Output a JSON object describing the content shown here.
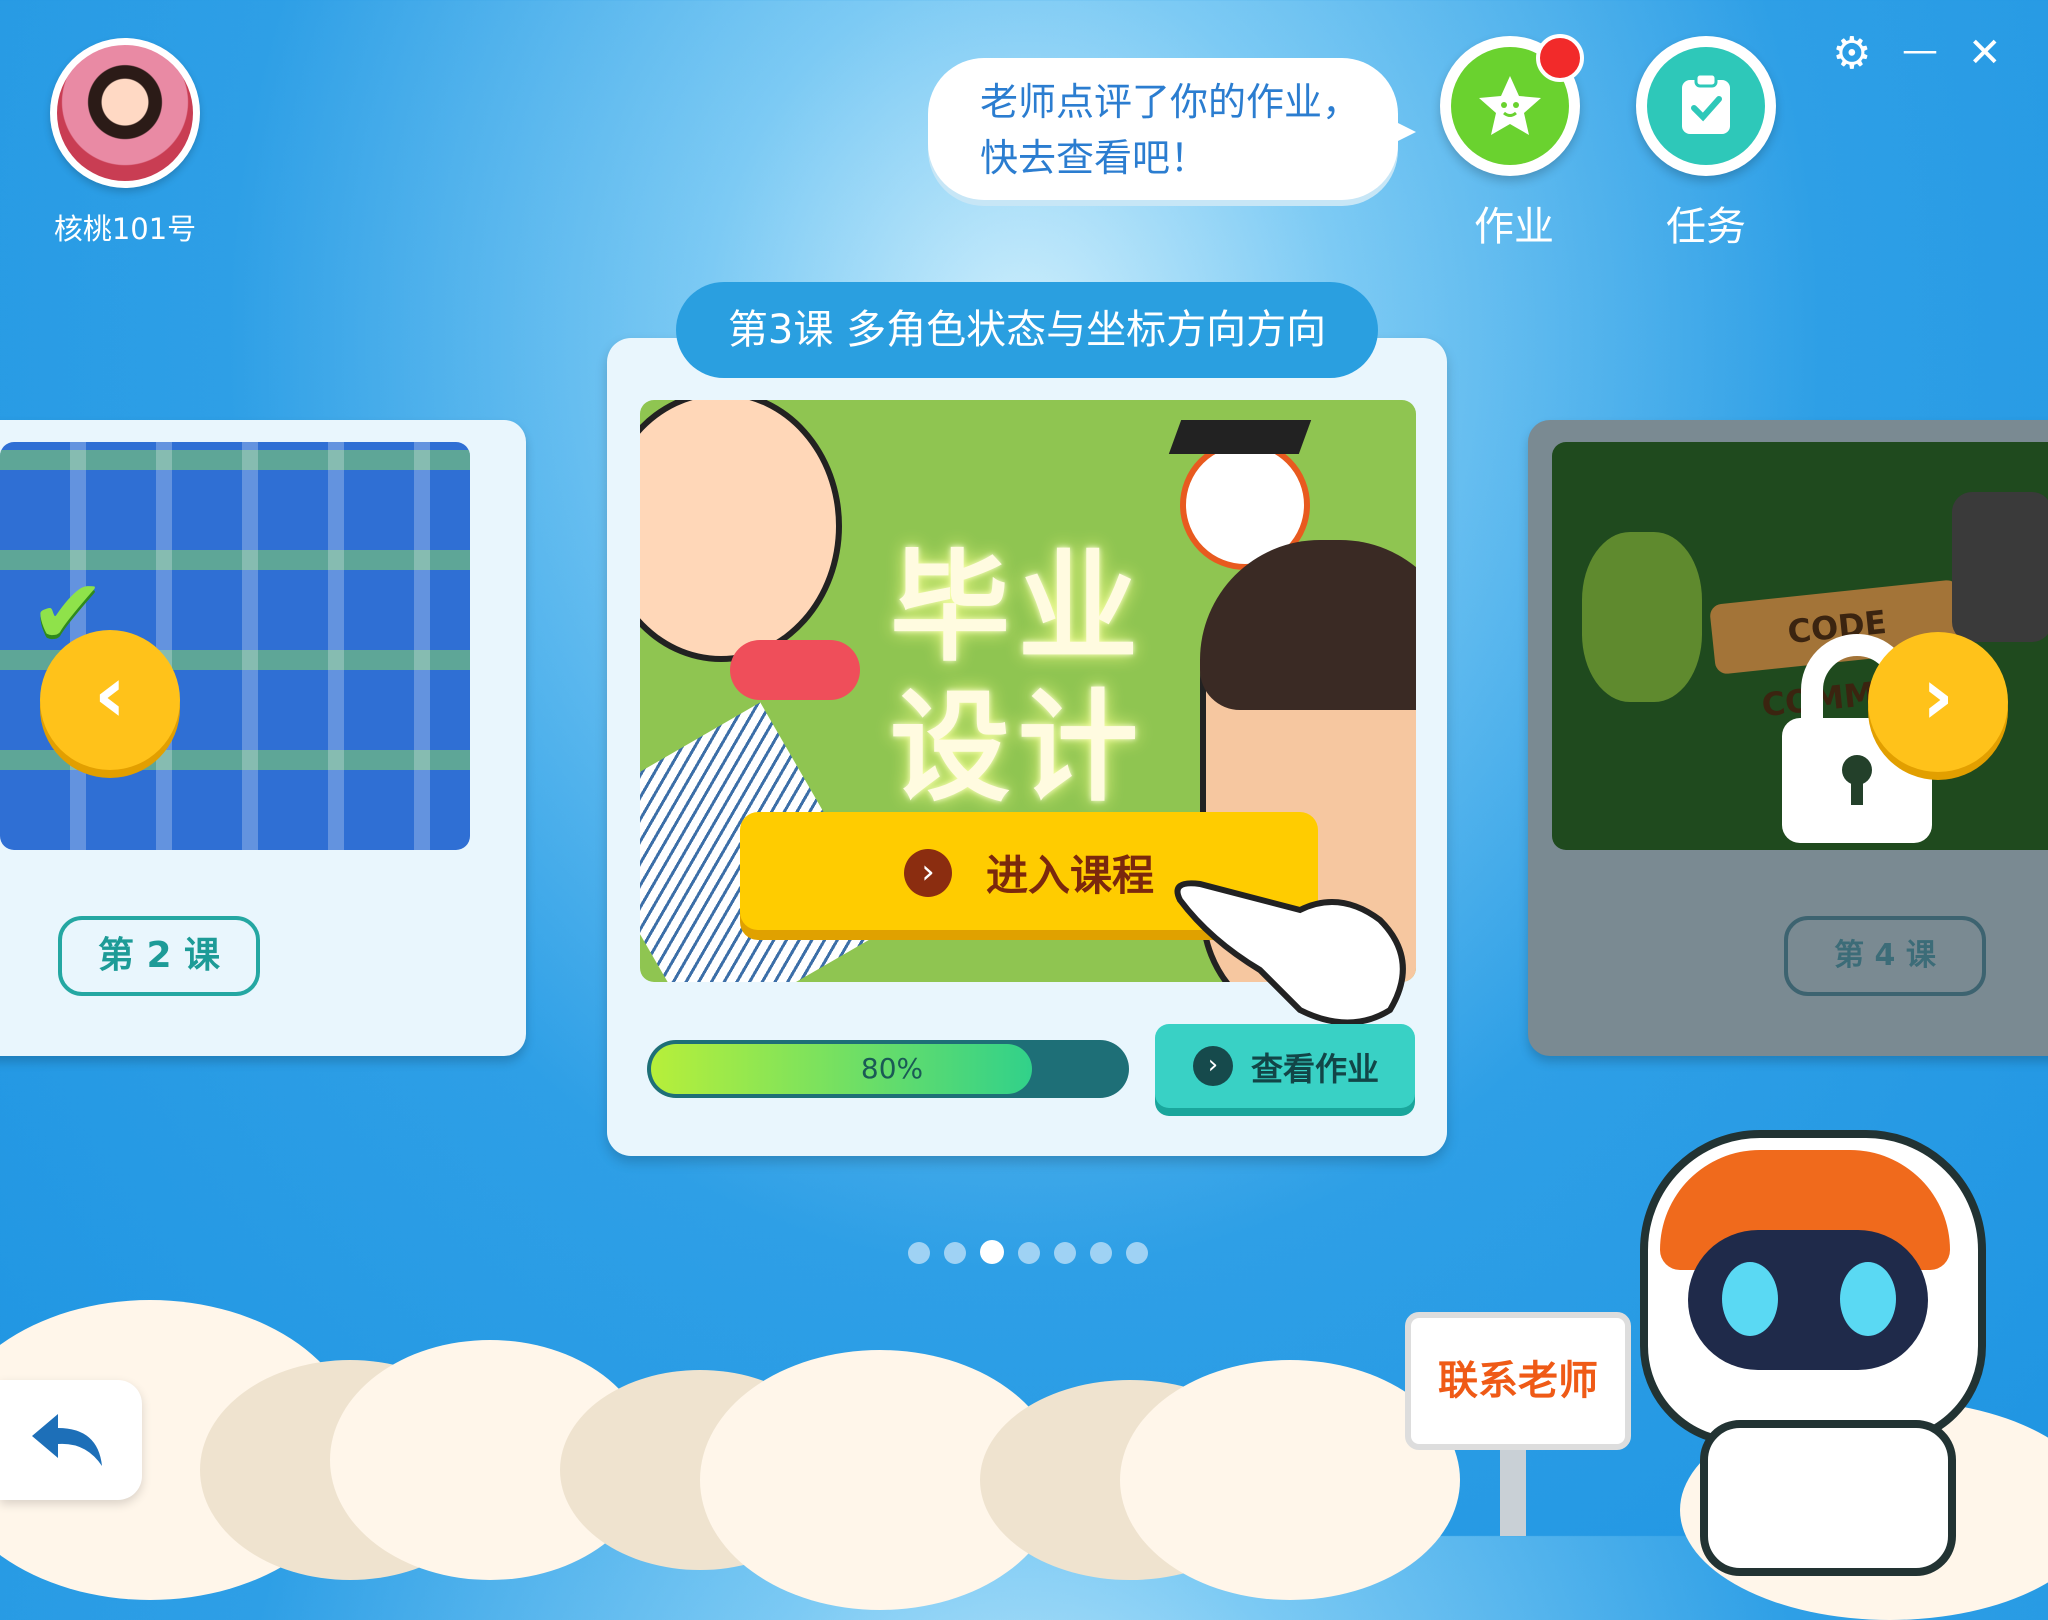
{
  "profile": {
    "username": "核桃101号"
  },
  "notification": {
    "text_line1": "老师点评了你的作业，",
    "text_line2": "快去查看吧！"
  },
  "top_buttons": {
    "homework_label": "作业",
    "tasks_label": "任务"
  },
  "window_controls": {
    "settings": "⚙",
    "minimize": "—",
    "close": "✕"
  },
  "lessons": {
    "previous": {
      "label": "第 2 课"
    },
    "current": {
      "title": "第3课   多角色状态与坐标方向方向",
      "art_title_line1": "毕业",
      "art_title_line2": "设计",
      "enter_label": "进入课程",
      "progress_text": "80%",
      "progress_value": 0.8,
      "view_homework_label": "查看作业"
    },
    "next": {
      "label": "第 4 课",
      "locked": true,
      "art_text": "CODE COMMAN"
    }
  },
  "pagination": {
    "total": 7,
    "active_index": 2
  },
  "contact": {
    "label": "联系老师"
  },
  "colors": {
    "accent_yellow": "#ffcc00",
    "teal": "#39d1c5",
    "red_dot": "#f22a2a",
    "bg_blue": "#1f95e2"
  },
  "icons": {
    "homework": "star-icon",
    "tasks": "clipboard-check-icon",
    "back": "back-arrow-icon",
    "lock": "lock-icon",
    "prev": "chevron-left-icon",
    "next": "chevron-right-icon"
  }
}
